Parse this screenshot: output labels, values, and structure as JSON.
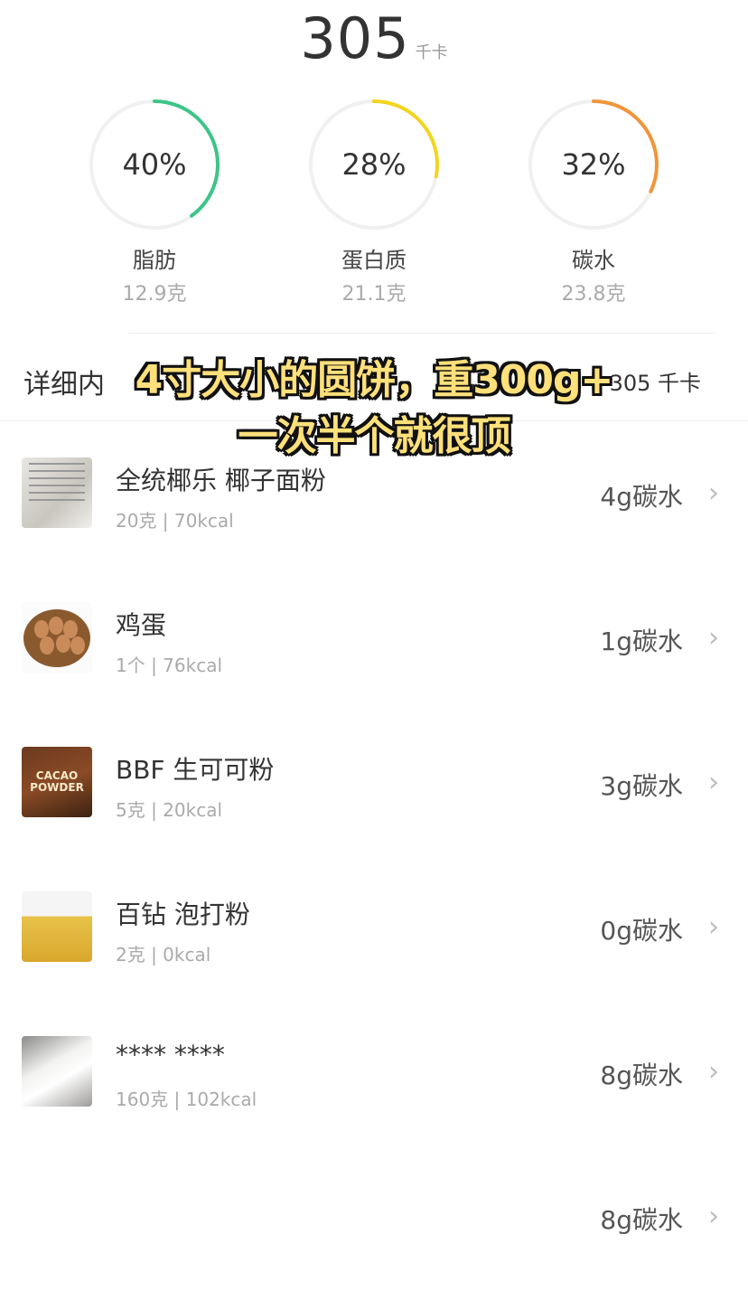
{
  "total": {
    "value": "305",
    "unit": "千卡"
  },
  "macros": [
    {
      "percent": "40%",
      "fraction": 0.4,
      "name": "脂肪",
      "grams": "12.9克",
      "color": "#3cc587"
    },
    {
      "percent": "28%",
      "fraction": 0.28,
      "name": "蛋白质",
      "grams": "21.1克",
      "color": "#f2d51f"
    },
    {
      "percent": "32%",
      "fraction": 0.32,
      "name": "碳水",
      "grams": "23.8克",
      "color": "#f0953a"
    }
  ],
  "detail": {
    "title": "详细内",
    "kcal": "305 千卡"
  },
  "banner": {
    "line1": "4寸大小的圆饼，重300g+",
    "line2": "一次半个就很顶"
  },
  "items": [
    {
      "name": "全统椰乐 椰子面粉",
      "sub": "20克 | 70kcal",
      "carb": "4g碳水",
      "thumb": "coconut-flour-package"
    },
    {
      "name": "鸡蛋",
      "sub": "1个 | 76kcal",
      "carb": "1g碳水",
      "thumb": "eggs-basket"
    },
    {
      "name": "BBF 生可可粉",
      "sub": "5克 | 20kcal",
      "carb": "3g碳水",
      "thumb": "cacao-powder-bag",
      "thumb_text": "CACAO POWDER"
    },
    {
      "name": "百钻 泡打粉",
      "sub": "2克 | 0kcal",
      "carb": "0g碳水",
      "thumb": "baking-powder-package"
    },
    {
      "name": "**** ****",
      "sub": "160克 | 102kcal",
      "carb": "8g碳水",
      "thumb": "white-cream"
    },
    {
      "name": "",
      "sub": "",
      "carb": "8g碳水",
      "thumb": ""
    }
  ],
  "chevron": "›"
}
